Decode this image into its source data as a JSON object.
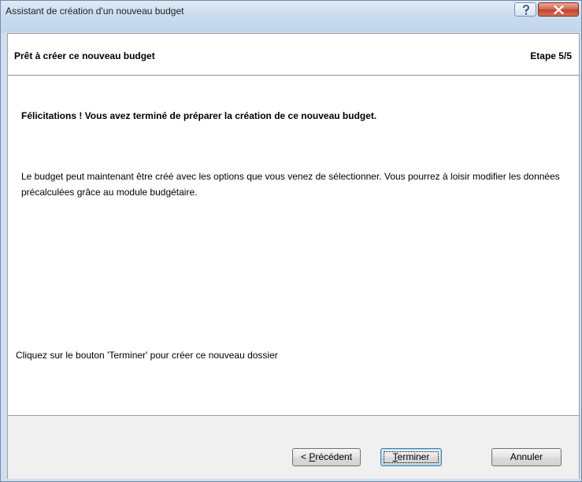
{
  "window": {
    "title": "Assistant de création d'un nouveau budget",
    "help_icon": "question-mark-icon",
    "close_icon": "close-x-icon"
  },
  "header": {
    "title": "Prêt à créer ce nouveau budget",
    "step": "Etape 5/5"
  },
  "content": {
    "congratulations": "Félicitations ! Vous avez terminé de préparer la création de ce nouveau budget.",
    "description": "Le budget peut maintenant être créé avec les options que vous venez de sélectionner. Vous pourrez à loisir modifier les données précalculées grâce au module budgétaire.",
    "instruction": "Cliquez sur le bouton 'Terminer' pour créer ce nouveau dossier"
  },
  "buttons": {
    "previous": {
      "prefix": "< ",
      "accel": "P",
      "rest": "récédent"
    },
    "finish": {
      "accel": "T",
      "rest": "erminer"
    },
    "cancel": "Annuler"
  }
}
